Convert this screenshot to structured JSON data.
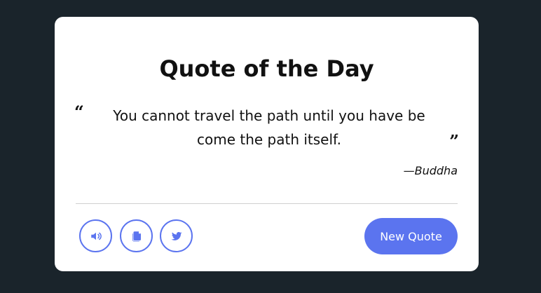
{
  "card": {
    "title": "Quote of the Day",
    "quote": "You cannot travel the path until you have be come the path itself.",
    "author": "—Buddha"
  },
  "actions": {
    "new_quote_label": "New Quote",
    "icons": [
      "volume-icon",
      "copy-icon",
      "twitter-icon"
    ]
  },
  "colors": {
    "page_background": "#1a242b",
    "card_background": "#ffffff",
    "accent": "#5b74ef",
    "divider": "#cfcfcf",
    "text": "#111111"
  }
}
